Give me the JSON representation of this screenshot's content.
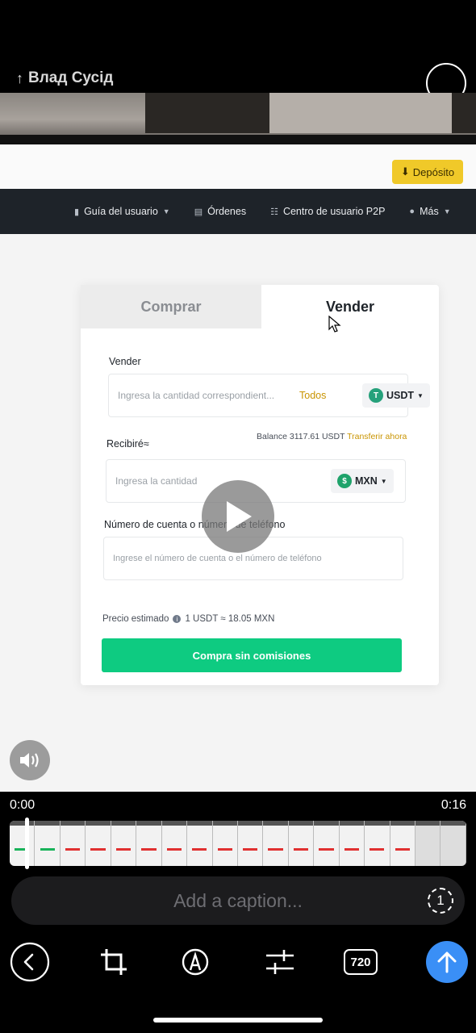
{
  "header": {
    "recipient": "Влад Сусід"
  },
  "site": {
    "deposit_label": "Depósito",
    "nav": [
      {
        "label": "Guía del usuario",
        "icon": "book-icon"
      },
      {
        "label": "Órdenes",
        "icon": "document-icon"
      },
      {
        "label": "Centro de usuario P2P",
        "icon": "user-center-icon"
      },
      {
        "label": "Más",
        "icon": "more-icon"
      }
    ],
    "tabs": {
      "buy": "Comprar",
      "sell": "Vender"
    },
    "sell_label": "Vender",
    "sell_placeholder": "Ingresa la cantidad correspondient...",
    "todos": "Todos",
    "sell_coin": "USDT",
    "balance_text": "Balance 3117.61 USDT",
    "balance_link": "Transferir ahora",
    "receive_label": "Recibiré≈",
    "receive_placeholder": "Ingresa la cantidad",
    "receive_coin": "MXN",
    "account_label": "Número de cuenta o número de teléfono",
    "account_placeholder": "Ingrese el número de cuenta o el número de teléfono",
    "precio_label": "Precio estimado",
    "precio_value": "1 USDT ≈ 18.05 MXN",
    "cta_label": "Compra sin comisiones"
  },
  "timeline": {
    "start_time": "0:00",
    "end_time": "0:16"
  },
  "caption": {
    "placeholder": "Add a caption..."
  },
  "toolbar": {
    "quality": "720"
  },
  "colors": {
    "accent": "#3a8ff6",
    "buy_green": "#0ecb81",
    "binance_yellow": "#f0c929"
  }
}
